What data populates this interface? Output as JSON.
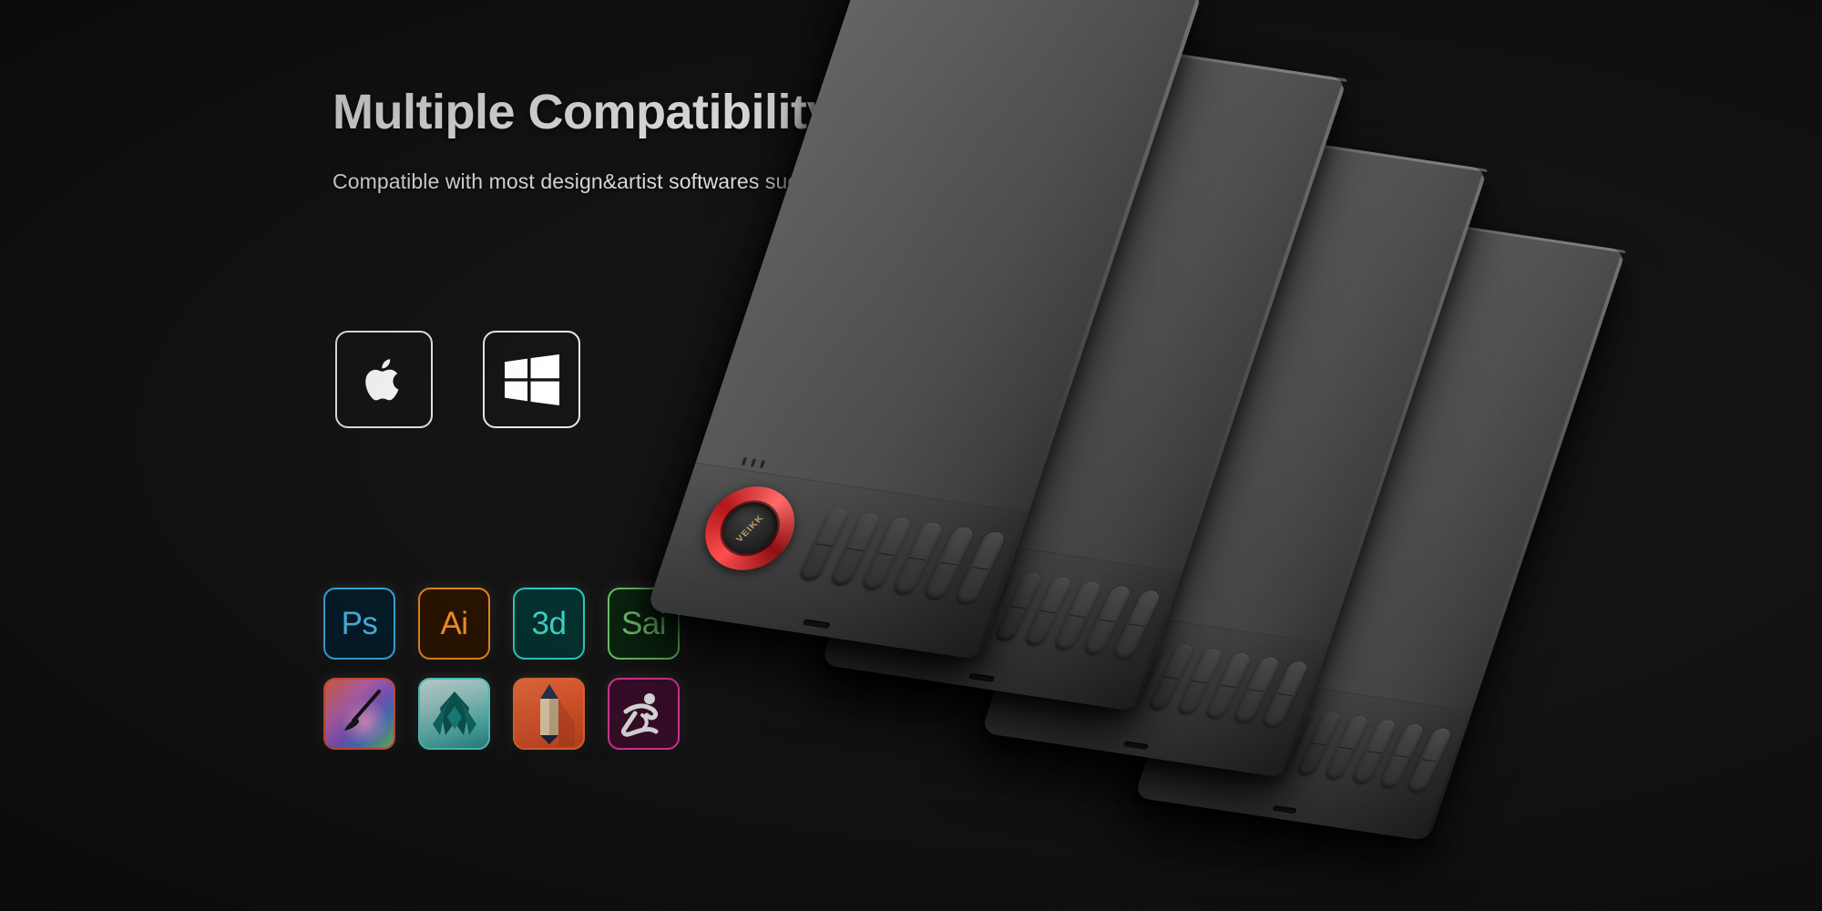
{
  "background_color": "#141414",
  "heading": "Multiple Compatibility",
  "subheading": "Compatible with most design&artist softwares such as PS, AI, krita, Painter...",
  "os_support": {
    "items": [
      {
        "name": "apple-macos",
        "label": "macOS"
      },
      {
        "name": "windows",
        "label": "Windows"
      }
    ]
  },
  "software": {
    "row1": [
      {
        "id": "ps",
        "glyph": "Ps",
        "label": "Adobe Photoshop",
        "accent": "#4fc3f0"
      },
      {
        "id": "ai",
        "glyph": "Ai",
        "label": "Adobe Illustrator",
        "accent": "#ff9a23"
      },
      {
        "id": "3d",
        "glyph": "3d",
        "label": "Adobe Dimension 3d",
        "accent": "#3fd9ce"
      },
      {
        "id": "sai",
        "glyph": "Sai",
        "label": "PaintTool SAI",
        "accent": "#7ed87e"
      }
    ],
    "row2": [
      {
        "id": "painter",
        "glyph": "",
        "label": "Corel Painter",
        "accent": "#e2553d"
      },
      {
        "id": "maya",
        "glyph": "",
        "label": "Autodesk Maya",
        "accent": "#57d7d2"
      },
      {
        "id": "sketchbook",
        "glyph": "",
        "label": "Autodesk SketchBook",
        "accent": "#ef6a35"
      },
      {
        "id": "zbrush",
        "glyph": "",
        "label": "ZBrush",
        "accent": "#e0399f"
      }
    ]
  },
  "product": {
    "brand": "VEIKK",
    "express_key_count": 6,
    "led_count": 3,
    "tablets": [
      {
        "id": "t1",
        "dial_color_name": "red",
        "dial_color": "#ff4d4d"
      },
      {
        "id": "t2",
        "dial_color_name": "blue",
        "dial_color": "#5f6bff"
      },
      {
        "id": "t3",
        "dial_color_name": "gold",
        "dial_color": "#e8cf8f"
      },
      {
        "id": "t4",
        "dial_color_name": "silver",
        "dial_color": "#e2e2e2"
      }
    ]
  }
}
